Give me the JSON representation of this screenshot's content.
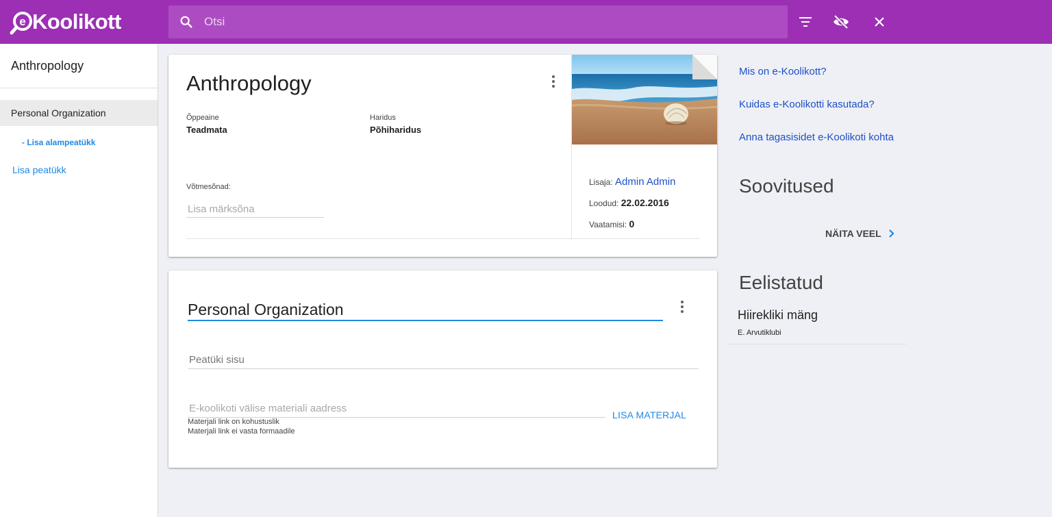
{
  "app": {
    "logo_text": "Koolikott",
    "logo_prefix": "e",
    "search_placeholder": "Otsi"
  },
  "toolbar": {
    "icons": [
      "search-icon",
      "filter-icon",
      "eye-off-icon",
      "close-icon"
    ]
  },
  "sidebar": {
    "title": "Anthropology",
    "items": [
      {
        "label": "Personal Organization",
        "active": true
      },
      {
        "label": "- Lisa alampeatükk"
      },
      {
        "label": "Lisa peatükk"
      }
    ]
  },
  "material": {
    "title": "Anthropology",
    "subject_label": "Õppeaine",
    "subject_value": "Teadmata",
    "education_label": "Haridus",
    "education_value": "Põhiharidus",
    "keywords_label": "Võtmesõnad:",
    "keywords_placeholder": "Lisa märksõna",
    "added_by_label": "Lisaja:",
    "added_by_value": "Admin Admin",
    "created_label": "Loodud:",
    "created_value": "22.02.2016",
    "views_label": "Vaatamisi:",
    "views_value": "0"
  },
  "chapter": {
    "title": "Personal Organization",
    "content_placeholder": "Peatüki sisu",
    "url_placeholder": "E-koolikoti välise materiali aadress",
    "hint_required": "Materjali link on kohustuslik",
    "hint_format": "Materjali link ei vasta formaadile",
    "add_button": "LISA MATERJAL"
  },
  "right": {
    "links": [
      "Mis on e-Koolikott?",
      "Kuidas e-Koolikotti kasutada?",
      "Anna tagasisidet e-Koolikoti kohta"
    ],
    "recommendations_title": "Soovitused",
    "show_more": "NÄITA VEEL",
    "favorites_title": "Eelistatud",
    "favorite_item_title": "Hiirekliki mäng",
    "favorite_item_author": "E. Arvutiklubi"
  },
  "colors": {
    "topbar": "#9c2fb4",
    "search": "#ad4cc2",
    "link": "#1e4fc7",
    "accent": "#1e88e5"
  }
}
